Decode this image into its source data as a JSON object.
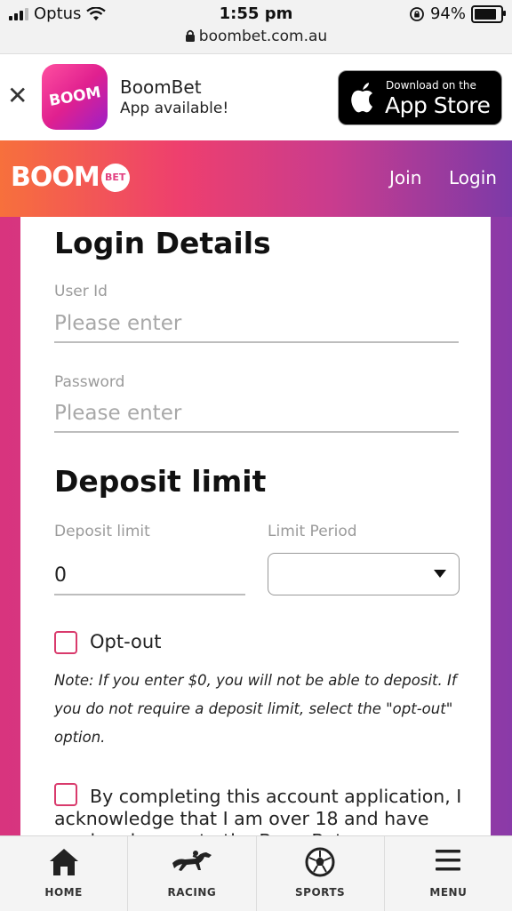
{
  "status_bar": {
    "carrier": "Optus",
    "time": "1:55 pm",
    "url": "boombet.com.au",
    "battery": "94%"
  },
  "app_banner": {
    "icon_text": "BOOM",
    "app_name": "BoomBet",
    "subtitle": "App available!",
    "store_small": "Download on the",
    "store_big": "App Store"
  },
  "header": {
    "logo_main": "BOOM",
    "logo_badge": "BET",
    "join": "Join",
    "login": "Login"
  },
  "login": {
    "title": "Login Details",
    "user_label": "User Id",
    "user_placeholder": "Please enter",
    "password_label": "Password",
    "password_placeholder": "Please enter"
  },
  "deposit": {
    "title": "Deposit limit",
    "limit_label": "Deposit limit",
    "limit_value": "0",
    "period_label": "Limit Period",
    "period_value": "",
    "optout_label": "Opt-out",
    "note": "Note: If you enter $0, you will not be able to deposit. If you do not require a deposit limit, select the \"opt-out\" option.",
    "agree_text": "By completing this account application, I acknowledge that I am over 18 and have read and agree to the BoomBet"
  },
  "nav": {
    "items": [
      {
        "label": "HOME",
        "icon": "home-icon"
      },
      {
        "label": "RACING",
        "icon": "horse-icon"
      },
      {
        "label": "SPORTS",
        "icon": "soccer-ball-icon"
      },
      {
        "label": "MENU",
        "icon": "hamburger-icon"
      }
    ]
  },
  "colors": {
    "accent_pink": "#e0208f",
    "checkbox_border": "#d93a6c"
  }
}
